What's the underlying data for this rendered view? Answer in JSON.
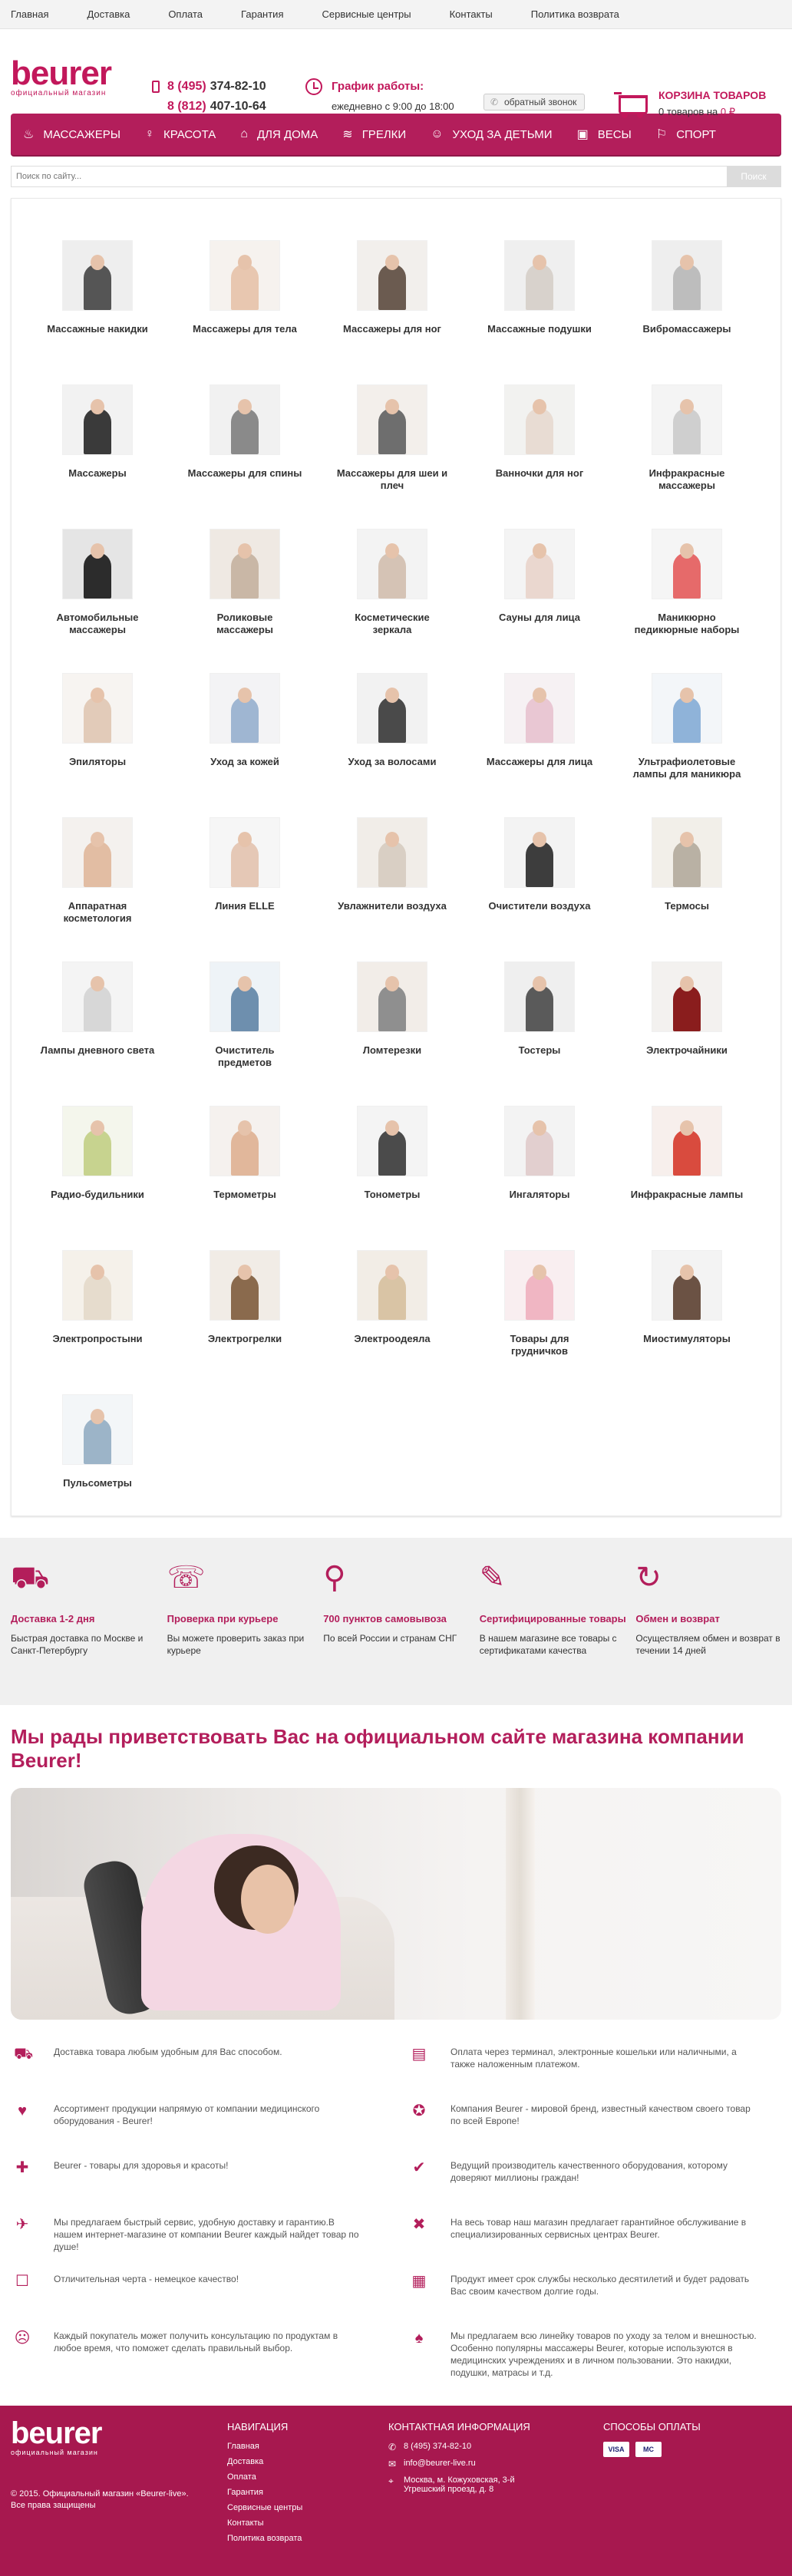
{
  "topnav": [
    "Главная",
    "Доставка",
    "Оплата",
    "Гарантия",
    "Сервисные центры",
    "Контакты",
    "Политика возврата"
  ],
  "header": {
    "logo": "beurer",
    "logo_sub": "официальный магазин",
    "phone1_code": "8 (495)",
    "phone1_num": "374-82-10",
    "phone2_code": "8 (812)",
    "phone2_num": "407-10-64",
    "schedule_title": "График работы:",
    "schedule_text": "ежедневно с 9:00 до 18:00",
    "callback": "обратный звонок",
    "cart_title": "КОРЗИНА ТОВАРОВ",
    "cart_text_prefix": "0 товаров на",
    "cart_amount": "0 ₽"
  },
  "mainnav": [
    {
      "label": "МАССАЖЕРЫ",
      "icon": "♨"
    },
    {
      "label": "КРАСОТА",
      "icon": "♀"
    },
    {
      "label": "ДЛЯ ДОМА",
      "icon": "⌂"
    },
    {
      "label": "ГРЕЛКИ",
      "icon": "≋"
    },
    {
      "label": "УХОД ЗА ДЕТЬМИ",
      "icon": "☺"
    },
    {
      "label": "ВЕСЫ",
      "icon": "▣"
    },
    {
      "label": "СПОРТ",
      "icon": "⚐"
    }
  ],
  "search": {
    "placeholder": "Поиск по сайту...",
    "button": "Поиск"
  },
  "categories": [
    {
      "label": "Массажные накидки",
      "bg": "#eeeeee",
      "fig": "#555555"
    },
    {
      "label": "Массажеры для тела",
      "bg": "#f6f2ee",
      "fig": "#e8c7b0"
    },
    {
      "label": "Массажеры для ног",
      "bg": "#f2efec",
      "fig": "#6b5b50"
    },
    {
      "label": "Массажные подушки",
      "bg": "#efefef",
      "fig": "#d8d2cc"
    },
    {
      "label": "Вибромассажеры",
      "bg": "#eeeeee",
      "fig": "#bdbdbd"
    },
    {
      "label": "Массажеры",
      "bg": "#f2f2f2",
      "fig": "#3a3a3a"
    },
    {
      "label": "Массажеры для спины",
      "bg": "#f1f1f1",
      "fig": "#8a8a8a"
    },
    {
      "label": "Массажеры для шеи и плеч",
      "bg": "#f3efeb",
      "fig": "#6e6e6e"
    },
    {
      "label": "Ванночки для ног",
      "bg": "#f2f2f0",
      "fig": "#e8dcd3"
    },
    {
      "label": "Инфракрасные массажеры",
      "bg": "#f4f4f4",
      "fig": "#cfcfcf"
    },
    {
      "label": "Автомобильные массажеры",
      "bg": "#e5e5e5",
      "fig": "#2c2c2c"
    },
    {
      "label": "Роликовые массажеры",
      "bg": "#efe9e3",
      "fig": "#c9b7a6"
    },
    {
      "label": "Косметические зеркала",
      "bg": "#f3f3f3",
      "fig": "#d5c3b5"
    },
    {
      "label": "Сауны для лица",
      "bg": "#f4f4f4",
      "fig": "#ead7cf"
    },
    {
      "label": "Маникюрно педикюрные наборы",
      "bg": "#f5f5f5",
      "fig": "#e66a6a"
    },
    {
      "label": "Эпиляторы",
      "bg": "#f7f4f1",
      "fig": "#e2cbb9"
    },
    {
      "label": "Уход за кожей",
      "bg": "#f3f3f5",
      "fig": "#9fb6d2"
    },
    {
      "label": "Уход за волосами",
      "bg": "#f2f2f2",
      "fig": "#4a4a4a"
    },
    {
      "label": "Массажеры для лица",
      "bg": "#f6f1f3",
      "fig": "#e9c7d3"
    },
    {
      "label": "Ультрафиолетовые лампы для маникюра",
      "bg": "#f3f6f9",
      "fig": "#8fb3d9"
    },
    {
      "label": "Аппаратная косметология",
      "bg": "#f4f1ee",
      "fig": "#e2bda3"
    },
    {
      "label": "Линия ELLE",
      "bg": "#f6f6f6",
      "fig": "#e5c8b6"
    },
    {
      "label": "Увлажнители воздуха",
      "bg": "#f1ede8",
      "fig": "#d9cfc4"
    },
    {
      "label": "Очистители воздуха",
      "bg": "#f3f3f3",
      "fig": "#3d3d3d"
    },
    {
      "label": "Термосы",
      "bg": "#f2efe9",
      "fig": "#b9b1a4"
    },
    {
      "label": "Лампы дневного света",
      "bg": "#f4f4f4",
      "fig": "#d7d7d7"
    },
    {
      "label": "Очиститель предметов",
      "bg": "#eef3f7",
      "fig": "#6e8fae"
    },
    {
      "label": "Ломтерезки",
      "bg": "#f2ede8",
      "fig": "#8f8f8f"
    },
    {
      "label": "Тостеры",
      "bg": "#efefef",
      "fig": "#5a5a5a"
    },
    {
      "label": "Электрочайники",
      "bg": "#f3f1ef",
      "fig": "#8a1d1d"
    },
    {
      "label": "Радио-будильники",
      "bg": "#f4f6ec",
      "fig": "#c7d38f"
    },
    {
      "label": "Термометры",
      "bg": "#f5f1ee",
      "fig": "#e1b79b"
    },
    {
      "label": "Тонометры",
      "bg": "#f4f4f4",
      "fig": "#4b4b4b"
    },
    {
      "label": "Ингаляторы",
      "bg": "#f3f3f3",
      "fig": "#e2cfcf"
    },
    {
      "label": "Инфракрасные лампы",
      "bg": "#f7efec",
      "fig": "#d94b3e"
    },
    {
      "label": "Электропростыни",
      "bg": "#f5f1ea",
      "fig": "#e6dccd"
    },
    {
      "label": "Электрогрелки",
      "bg": "#f1ece6",
      "fig": "#8a6a4d"
    },
    {
      "label": "Электроодеяла",
      "bg": "#f2ede6",
      "fig": "#d9c4a5"
    },
    {
      "label": "Товары для грудничков",
      "bg": "#f9eef0",
      "fig": "#f0b6c3"
    },
    {
      "label": "Миостимуляторы",
      "bg": "#f3f3f3",
      "fig": "#6b5244"
    },
    {
      "label": "Пульсометры",
      "bg": "#f3f6f8",
      "fig": "#9cb4c8"
    }
  ],
  "benefits": [
    {
      "icon": "⛟",
      "title": "Доставка 1-2 дня",
      "text": "Быстрая доставка по Москве и Санкт-Петербургу"
    },
    {
      "icon": "☏",
      "title": "Проверка при курьере",
      "text": "Вы можете проверить заказ при курьере"
    },
    {
      "icon": "⚲",
      "title": "700 пунктов самовывоза",
      "text": "По всей России и странам СНГ"
    },
    {
      "icon": "✎",
      "title": "Сертифицированные товары",
      "text": "В нашем магазине все товары с сертификатами качества"
    },
    {
      "icon": "↻",
      "title": "Обмен и возврат",
      "text": "Осуществляем обмен и возврат в течении 14 дней"
    }
  ],
  "welcome_title": "Мы рады приветствовать Вас на официальном сайте магазина компании Beurer!",
  "features": [
    {
      "icon": "⛟",
      "text": "Доставка товара любым удобным для Вас способом."
    },
    {
      "icon": "▤",
      "text": "Оплата через терминал, электронные кошельки или наличными, а также наложенным платежом."
    },
    {
      "icon": "♥",
      "text": "Ассортимент продукции напрямую от компании медицинского оборудования - Beurer!"
    },
    {
      "icon": "✪",
      "text": "Компания Beurer - мировой бренд, известный качеством своего товар по всей Европе!"
    },
    {
      "icon": "✚",
      "text": "Beurer - товары для здоровья и красоты!"
    },
    {
      "icon": "✔",
      "text": "Ведущий производитель качественного оборудования, которому доверяют миллионы граждан!"
    },
    {
      "icon": "✈",
      "text": "Мы предлагаем быстрый сервис, удобную доставку и гарантию.В нашем интернет-магазине от компании Beurer каждый найдет товар по душе!"
    },
    {
      "icon": "✖",
      "text": "На весь товар наш магазин предлагает гарантийное обслуживание в специализированных сервисных центрах Beurer."
    },
    {
      "icon": "☐",
      "text": "Отличительная черта - немецкое качество!"
    },
    {
      "icon": "▦",
      "text": "Продукт имеет срок службы несколько десятилетий и будет радовать Вас своим качеством долгие годы."
    },
    {
      "icon": "☹",
      "text": "Каждый покупатель может получить консультацию по продуктам в любое время, что поможет сделать правильный выбор."
    },
    {
      "icon": "♠",
      "text": "Мы предлагаем всю линейку товаров по уходу за телом и внешностью. Особенно популярны массажеры Beurer, которые используются в медицинских учреждениях и в личном пользовании. Это накидки, подушки, матрасы и т.д."
    }
  ],
  "footer": {
    "logo": "beurer",
    "logo_sub": "официальный магазин",
    "copy1": "© 2015. Официальный магазин «Beurer-live».",
    "copy2": "Все права защищены",
    "nav_title": "НАВИГАЦИЯ",
    "nav": [
      "Главная",
      "Доставка",
      "Оплата",
      "Гарантия",
      "Сервисные центры",
      "Контакты",
      "Политика возврата"
    ],
    "contact_title": "КОНТАКТНАЯ ИНФОРМАЦИЯ",
    "contact_phone": "8 (495) 374-82-10",
    "contact_email": "info@beurer-live.ru",
    "contact_addr": "Москва, м. Кожуховская, 3-й Угрешский проезд, д. 8",
    "pay_title": "СПОСОБЫ ОПЛАТЫ",
    "pay": [
      "VISA",
      "MC"
    ]
  }
}
